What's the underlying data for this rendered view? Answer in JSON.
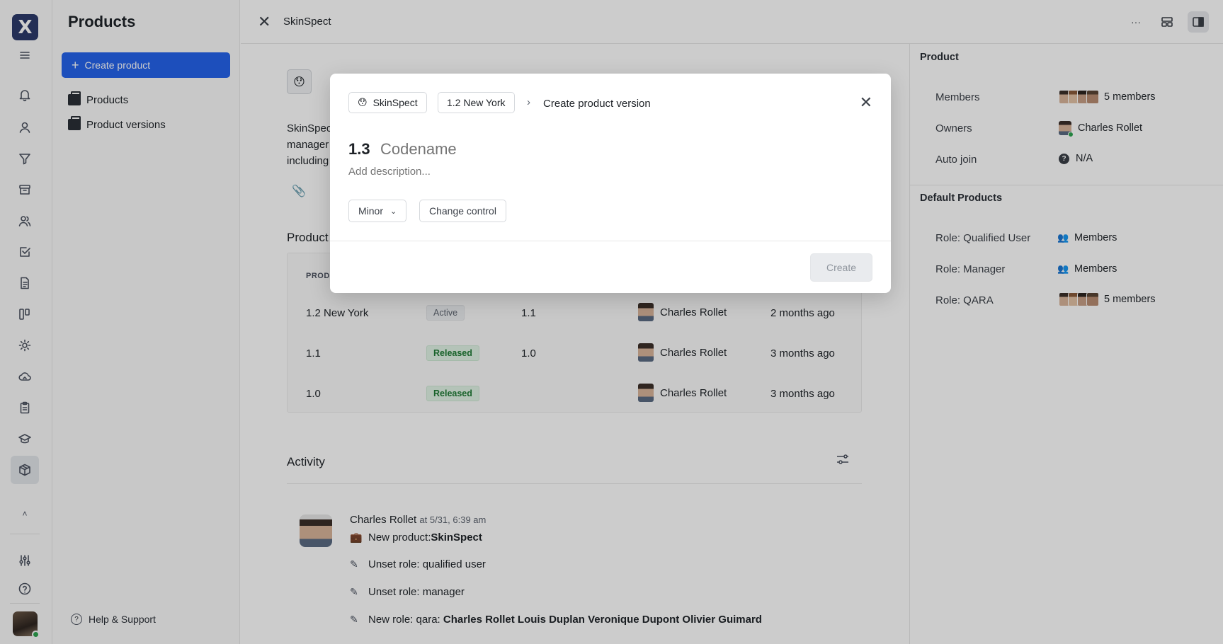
{
  "rail": {
    "logo": "X",
    "items": [
      "menu-icon",
      "bell-icon",
      "user-icon",
      "filter-icon",
      "archive-icon",
      "people-icon",
      "check-square-icon",
      "document-icon",
      "board-icon",
      "sun-icon",
      "cloud-icon",
      "clipboard-icon",
      "graduation-icon",
      "package-icon"
    ],
    "collapse_label": "˄"
  },
  "sidebar": {
    "title": "Products",
    "create_label": "Create product",
    "items": [
      {
        "label": "Products"
      },
      {
        "label": "Product versions"
      }
    ],
    "help_label": "Help & Support"
  },
  "topbar": {
    "title": "SkinSpect",
    "more_label": "···"
  },
  "content": {
    "emoji": "😯",
    "desc_lines": [
      "SkinSpec",
      "manager",
      "including"
    ],
    "versions_title": "Product",
    "table_header": "PRODU",
    "rows": [
      {
        "name": "1.2 New York",
        "status": "Active",
        "base": "1.1",
        "owner": "Charles Rollet",
        "time": "2 months ago"
      },
      {
        "name": "1.1",
        "status": "Released",
        "base": "1.0",
        "owner": "Charles Rollet",
        "time": "3 months ago"
      },
      {
        "name": "1.0",
        "status": "Released",
        "base": "",
        "owner": "Charles Rollet",
        "time": "3 months ago"
      }
    ],
    "activity_title": "Activity",
    "activity": {
      "author": "Charles Rollet",
      "at": "at 5/31, 6:39 am",
      "items": [
        {
          "prefix": "New product: ",
          "bold": "SkinSpect"
        },
        {
          "prefix": "Unset role: qualified user",
          "bold": ""
        },
        {
          "prefix": "Unset role: manager",
          "bold": ""
        },
        {
          "prefix": "New role: qara: ",
          "bold": "Charles Rollet Louis Duplan Veronique Dupont Olivier Guimard"
        }
      ]
    }
  },
  "right_panel": {
    "product_head": "Product",
    "members_label": "Members",
    "members_value": "5 members",
    "owners_label": "Owners",
    "owners_value": "Charles Rollet",
    "autojoin_label": "Auto join",
    "autojoin_value": "N/A",
    "defaults_head": "Default Products",
    "roles": [
      {
        "label": "Role: Qualified User",
        "value": "Members"
      },
      {
        "label": "Role: Manager",
        "value": "Members"
      },
      {
        "label": "Role: QARA",
        "value": "5 members"
      }
    ]
  },
  "modal": {
    "chip_product": "SkinSpect",
    "chip_product_emoji": "😯",
    "chip_version": "1.2 New York",
    "sep": "›",
    "title": "Create product version",
    "version_number": "1.3",
    "codename_placeholder": "Codename",
    "description_placeholder": "Add description...",
    "type_value": "Minor",
    "change_control_label": "Change control",
    "create_label": "Create"
  }
}
